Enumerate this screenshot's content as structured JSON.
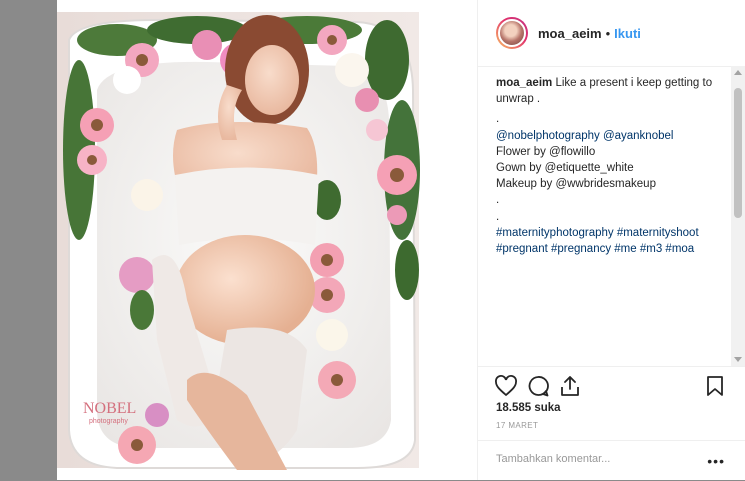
{
  "post": {
    "username": "moa_aeim",
    "dot": "•",
    "follow_label": "Ikuti",
    "caption": {
      "username": "moa_aeim",
      "first_line": " Like a present i keep getting to unwrap .",
      "lines": [
        ".",
        "@nobelphotography @ayanknobel",
        "Flower by @flowillo",
        "Gown by @etiquette_white",
        "Makeup by @wwbridesmakeup",
        ".",
        ".",
        "#maternityphotography #maternityshoot #pregnant #pregnancy #me #m3 #moa"
      ]
    },
    "likes": "18.585 suka",
    "date": "17 MARET",
    "comment_placeholder": "Tambahkan komentar...",
    "more_label": "•••",
    "watermark": {
      "title": "NOBEL",
      "sub": "photography"
    },
    "icons": [
      "heart-icon",
      "comment-icon",
      "share-icon",
      "bookmark-icon"
    ]
  },
  "colors": {
    "link": "#003569",
    "follow": "#3897f0",
    "backdrop": "#8a8a8a"
  }
}
